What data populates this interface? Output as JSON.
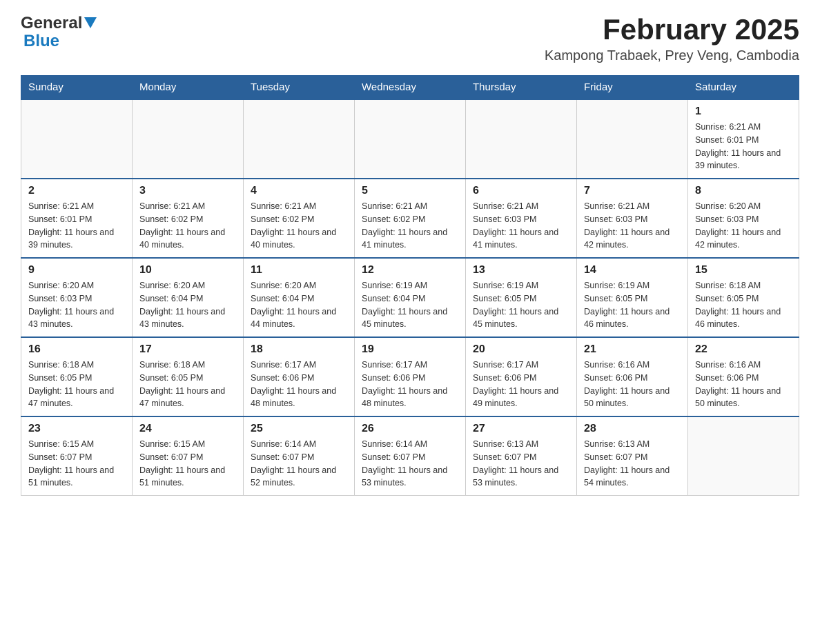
{
  "header": {
    "logo_general": "General",
    "logo_blue": "Blue",
    "title": "February 2025",
    "subtitle": "Kampong Trabaek, Prey Veng, Cambodia"
  },
  "days_of_week": [
    "Sunday",
    "Monday",
    "Tuesday",
    "Wednesday",
    "Thursday",
    "Friday",
    "Saturday"
  ],
  "weeks": [
    [
      {
        "day": "",
        "info": ""
      },
      {
        "day": "",
        "info": ""
      },
      {
        "day": "",
        "info": ""
      },
      {
        "day": "",
        "info": ""
      },
      {
        "day": "",
        "info": ""
      },
      {
        "day": "",
        "info": ""
      },
      {
        "day": "1",
        "info": "Sunrise: 6:21 AM\nSunset: 6:01 PM\nDaylight: 11 hours and 39 minutes."
      }
    ],
    [
      {
        "day": "2",
        "info": "Sunrise: 6:21 AM\nSunset: 6:01 PM\nDaylight: 11 hours and 39 minutes."
      },
      {
        "day": "3",
        "info": "Sunrise: 6:21 AM\nSunset: 6:02 PM\nDaylight: 11 hours and 40 minutes."
      },
      {
        "day": "4",
        "info": "Sunrise: 6:21 AM\nSunset: 6:02 PM\nDaylight: 11 hours and 40 minutes."
      },
      {
        "day": "5",
        "info": "Sunrise: 6:21 AM\nSunset: 6:02 PM\nDaylight: 11 hours and 41 minutes."
      },
      {
        "day": "6",
        "info": "Sunrise: 6:21 AM\nSunset: 6:03 PM\nDaylight: 11 hours and 41 minutes."
      },
      {
        "day": "7",
        "info": "Sunrise: 6:21 AM\nSunset: 6:03 PM\nDaylight: 11 hours and 42 minutes."
      },
      {
        "day": "8",
        "info": "Sunrise: 6:20 AM\nSunset: 6:03 PM\nDaylight: 11 hours and 42 minutes."
      }
    ],
    [
      {
        "day": "9",
        "info": "Sunrise: 6:20 AM\nSunset: 6:03 PM\nDaylight: 11 hours and 43 minutes."
      },
      {
        "day": "10",
        "info": "Sunrise: 6:20 AM\nSunset: 6:04 PM\nDaylight: 11 hours and 43 minutes."
      },
      {
        "day": "11",
        "info": "Sunrise: 6:20 AM\nSunset: 6:04 PM\nDaylight: 11 hours and 44 minutes."
      },
      {
        "day": "12",
        "info": "Sunrise: 6:19 AM\nSunset: 6:04 PM\nDaylight: 11 hours and 45 minutes."
      },
      {
        "day": "13",
        "info": "Sunrise: 6:19 AM\nSunset: 6:05 PM\nDaylight: 11 hours and 45 minutes."
      },
      {
        "day": "14",
        "info": "Sunrise: 6:19 AM\nSunset: 6:05 PM\nDaylight: 11 hours and 46 minutes."
      },
      {
        "day": "15",
        "info": "Sunrise: 6:18 AM\nSunset: 6:05 PM\nDaylight: 11 hours and 46 minutes."
      }
    ],
    [
      {
        "day": "16",
        "info": "Sunrise: 6:18 AM\nSunset: 6:05 PM\nDaylight: 11 hours and 47 minutes."
      },
      {
        "day": "17",
        "info": "Sunrise: 6:18 AM\nSunset: 6:05 PM\nDaylight: 11 hours and 47 minutes."
      },
      {
        "day": "18",
        "info": "Sunrise: 6:17 AM\nSunset: 6:06 PM\nDaylight: 11 hours and 48 minutes."
      },
      {
        "day": "19",
        "info": "Sunrise: 6:17 AM\nSunset: 6:06 PM\nDaylight: 11 hours and 48 minutes."
      },
      {
        "day": "20",
        "info": "Sunrise: 6:17 AM\nSunset: 6:06 PM\nDaylight: 11 hours and 49 minutes."
      },
      {
        "day": "21",
        "info": "Sunrise: 6:16 AM\nSunset: 6:06 PM\nDaylight: 11 hours and 50 minutes."
      },
      {
        "day": "22",
        "info": "Sunrise: 6:16 AM\nSunset: 6:06 PM\nDaylight: 11 hours and 50 minutes."
      }
    ],
    [
      {
        "day": "23",
        "info": "Sunrise: 6:15 AM\nSunset: 6:07 PM\nDaylight: 11 hours and 51 minutes."
      },
      {
        "day": "24",
        "info": "Sunrise: 6:15 AM\nSunset: 6:07 PM\nDaylight: 11 hours and 51 minutes."
      },
      {
        "day": "25",
        "info": "Sunrise: 6:14 AM\nSunset: 6:07 PM\nDaylight: 11 hours and 52 minutes."
      },
      {
        "day": "26",
        "info": "Sunrise: 6:14 AM\nSunset: 6:07 PM\nDaylight: 11 hours and 53 minutes."
      },
      {
        "day": "27",
        "info": "Sunrise: 6:13 AM\nSunset: 6:07 PM\nDaylight: 11 hours and 53 minutes."
      },
      {
        "day": "28",
        "info": "Sunrise: 6:13 AM\nSunset: 6:07 PM\nDaylight: 11 hours and 54 minutes."
      },
      {
        "day": "",
        "info": ""
      }
    ]
  ]
}
